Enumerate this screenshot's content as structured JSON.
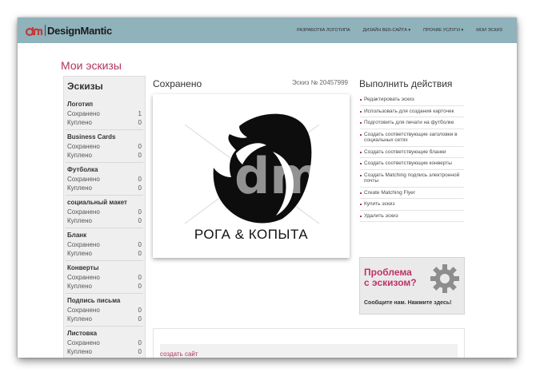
{
  "header": {
    "logo_text": "DesignMantic",
    "nav": [
      "РАЗРАБОТКА ЛОГОТИПА",
      "ДИЗАЙН ВЕБ-САЙТА ▾",
      "ПРОЧИЕ УСЛУГИ ▾",
      "МОИ ЭСКИЗ"
    ]
  },
  "page_title": "Мои эскизы",
  "sidebar": {
    "title": "Эскизы",
    "groups": [
      {
        "name": "Логотип",
        "saved_label": "Сохранено",
        "saved": "1",
        "bought_label": "Куплено",
        "bought": "0"
      },
      {
        "name": "Business Cards",
        "saved_label": "Сохранено",
        "saved": "0",
        "bought_label": "Куплено",
        "bought": "0"
      },
      {
        "name": "Футболка",
        "saved_label": "Сохранено",
        "saved": "0",
        "bought_label": "Куплено",
        "bought": "0"
      },
      {
        "name": "социальный макет",
        "saved_label": "Сохранено",
        "saved": "0",
        "bought_label": "Куплено",
        "bought": "0"
      },
      {
        "name": "Бланк",
        "saved_label": "Сохранено",
        "saved": "0",
        "bought_label": "Куплено",
        "bought": "0"
      },
      {
        "name": "Конверты",
        "saved_label": "Сохранено",
        "saved": "0",
        "bought_label": "Куплено",
        "bought": "0"
      },
      {
        "name": "Подпись письма",
        "saved_label": "Сохранено",
        "saved": "0",
        "bought_label": "Куплено",
        "bought": "0"
      },
      {
        "name": "Листовка",
        "saved_label": "Сохранено",
        "saved": "0",
        "bought_label": "Куплено",
        "bought": "0"
      }
    ]
  },
  "main": {
    "saved_title": "Сохранено",
    "sketch_number": "Эскиз № 20457999",
    "brand_name": "РОГА & КОПЫТА"
  },
  "actions": {
    "title": "Выполнить действия",
    "items": [
      "Редактировать эскиз",
      "Использовать для создания карточек",
      "Подготовить для печати на футболке",
      "Создать соответствующие заголовки в социальных сетях",
      "Создать соответствующие бланки",
      "Создать соответствующие конверты",
      "Создать Matching подпись электронной почты",
      "Create Matching Flyer",
      "Купить эскиз",
      "Удалить эскиз"
    ]
  },
  "banner": {
    "line1": "Проблема",
    "line2": "с эскизом?",
    "cta": "Сообщите нам. Нажмите здесь!"
  },
  "bottom": {
    "link": "создать сайт"
  }
}
